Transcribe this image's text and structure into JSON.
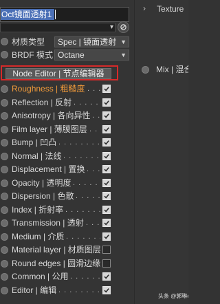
{
  "material_name": "Oct镜面透射1",
  "material_type": {
    "label": "材质类型",
    "value": "Spec | 镜面透射"
  },
  "brdf_mode": {
    "label": "BRDF 模式",
    "value": "Octane"
  },
  "node_editor_label": "Node Editor | 节点编辑器",
  "channels": [
    {
      "label": "Roughness | 粗糙度",
      "checked": true
    },
    {
      "label": "Reflection | 反射",
      "checked": true
    },
    {
      "label": "Anisotropy | 各向异性",
      "checked": true
    },
    {
      "label": "Film layer | 薄膜图层",
      "checked": true
    },
    {
      "label": "Bump | 凹凸",
      "checked": true
    },
    {
      "label": "Normal | 法线",
      "checked": true
    },
    {
      "label": "Displacement | 置换",
      "checked": true
    },
    {
      "label": "Opacity | 透明度",
      "checked": true
    },
    {
      "label": "Dispersion | 色散",
      "checked": true
    },
    {
      "label": "Index | 折射率",
      "checked": true
    },
    {
      "label": "Transmission | 透射",
      "checked": true
    },
    {
      "label": "Medium | 介质",
      "checked": true
    },
    {
      "label": "Material layer | 材质图层",
      "checked": false
    },
    {
      "label": "Round edges | 圆滑边缘",
      "checked": false
    },
    {
      "label": "Common | 公用",
      "checked": true
    },
    {
      "label": "Editor | 编辑",
      "checked": true
    }
  ],
  "right_panel": {
    "texture_label": "Texture",
    "mix_label": "Mix | 混合"
  },
  "watermark": "头条 @郭琳ei",
  "colors": {
    "accent_orange": "#f29b3a",
    "highlight_red": "#d62a2a",
    "selection_blue": "#4a6fb6"
  },
  "icons": {
    "pick": "crosshair-pick-icon",
    "checkbox": "checkmark-icon",
    "expand": "chevron-right-icon"
  }
}
